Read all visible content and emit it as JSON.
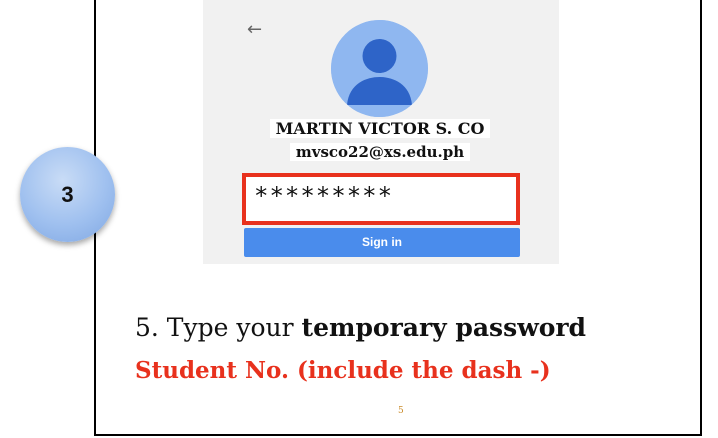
{
  "login": {
    "back_icon": "arrow-left-icon",
    "avatar_icon": "default-user-avatar",
    "user_name": "MARTIN VICTOR S. CO",
    "user_email": "mvsco22@xs.edu.ph",
    "password_masked": "*********",
    "signin_label": "Sign in"
  },
  "step": {
    "number": "3"
  },
  "instruction": {
    "prefix": "5. Type your ",
    "emphasis": "temporary password",
    "line2": "Student No. (include the dash -)"
  },
  "slide": {
    "page_number": "5"
  },
  "colors": {
    "highlight_red": "#e8311d",
    "button_blue": "#4a8cec",
    "avatar_blue": "#8fb7f0",
    "badge_blue": "#9fc0ef"
  }
}
